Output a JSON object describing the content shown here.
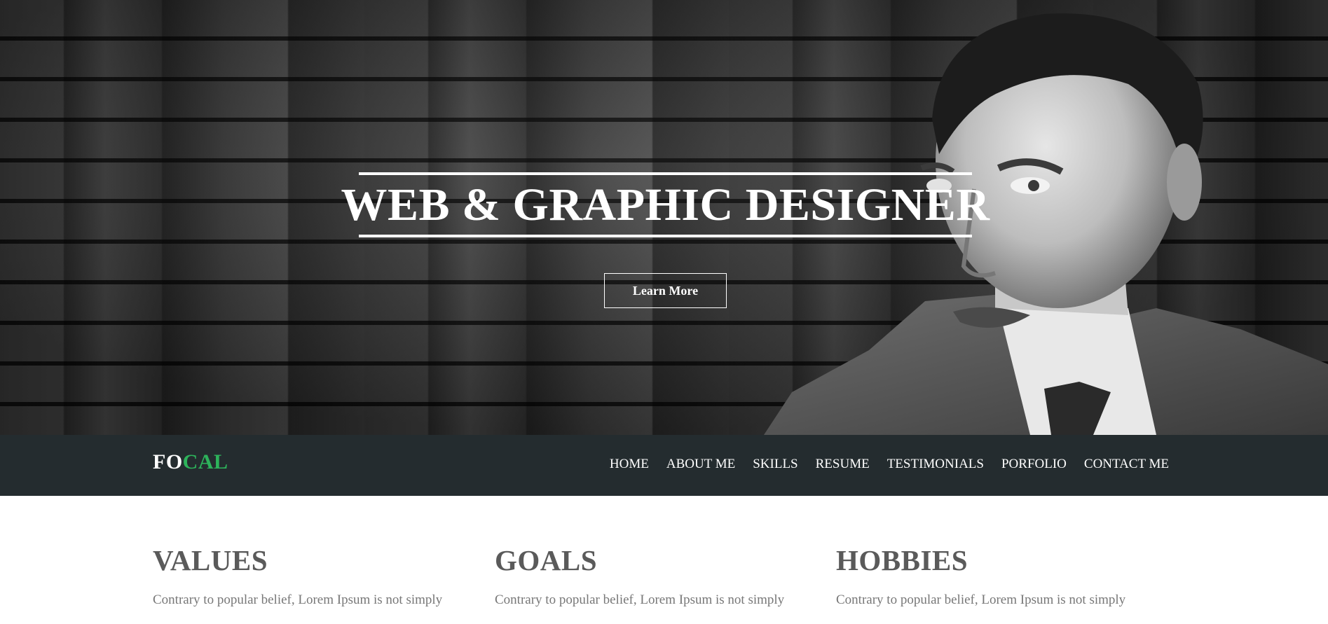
{
  "hero": {
    "title": "WEB & GRAPHIC DESIGNER",
    "cta_label": "Learn More"
  },
  "nav": {
    "logo_part1": "FO",
    "logo_part2": "CAL",
    "logo_accent_color": "#2db35b",
    "background_color": "#242c2f",
    "items": [
      {
        "label": "HOME"
      },
      {
        "label": "ABOUT ME"
      },
      {
        "label": "SKILLS"
      },
      {
        "label": "RESUME"
      },
      {
        "label": "TESTIMONIALS"
      },
      {
        "label": "PORFOLIO"
      },
      {
        "label": "CONTACT ME"
      }
    ]
  },
  "sections": [
    {
      "heading": "VALUES",
      "text": "Contrary to popular belief, Lorem Ipsum is not simply"
    },
    {
      "heading": "GOALS",
      "text": "Contrary to popular belief, Lorem Ipsum is not simply"
    },
    {
      "heading": "HOBBIES",
      "text": "Contrary to popular belief, Lorem Ipsum is not simply"
    }
  ]
}
